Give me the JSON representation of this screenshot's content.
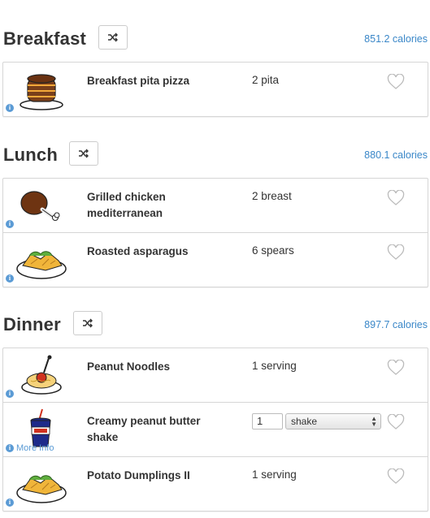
{
  "meals": [
    {
      "title": "Breakfast",
      "calories": "851.2 calories",
      "items": [
        {
          "name": "Breakfast pita pizza",
          "amount": "2 pita",
          "image": "pancakes-icon"
        }
      ]
    },
    {
      "title": "Lunch",
      "calories": "880.1 calories",
      "items": [
        {
          "name": "Grilled chicken mediterranean",
          "amount": "2 breast",
          "image": "chicken-leg-icon"
        },
        {
          "name": "Roasted asparagus",
          "amount": "6 spears",
          "image": "salad-plate-icon"
        }
      ]
    },
    {
      "title": "Dinner",
      "calories": "897.7 calories",
      "items": [
        {
          "name": "Peanut Noodles",
          "amount": "1 serving",
          "image": "spaghetti-icon"
        },
        {
          "name": "Creamy peanut butter shake",
          "quantity": "1",
          "unit": "shake",
          "more_info": "More Info",
          "image": "drink-cup-icon"
        },
        {
          "name": "Potato Dumplings II",
          "amount": "1 serving",
          "image": "salad-plate-icon"
        }
      ]
    }
  ],
  "icons": {
    "shuffle": "shuffle-icon",
    "heart": "heart-outline-icon",
    "info": "info-icon"
  },
  "colors": {
    "accent": "#3a87c8",
    "border": "#d6d6d6",
    "info": "#5b9bd5"
  }
}
